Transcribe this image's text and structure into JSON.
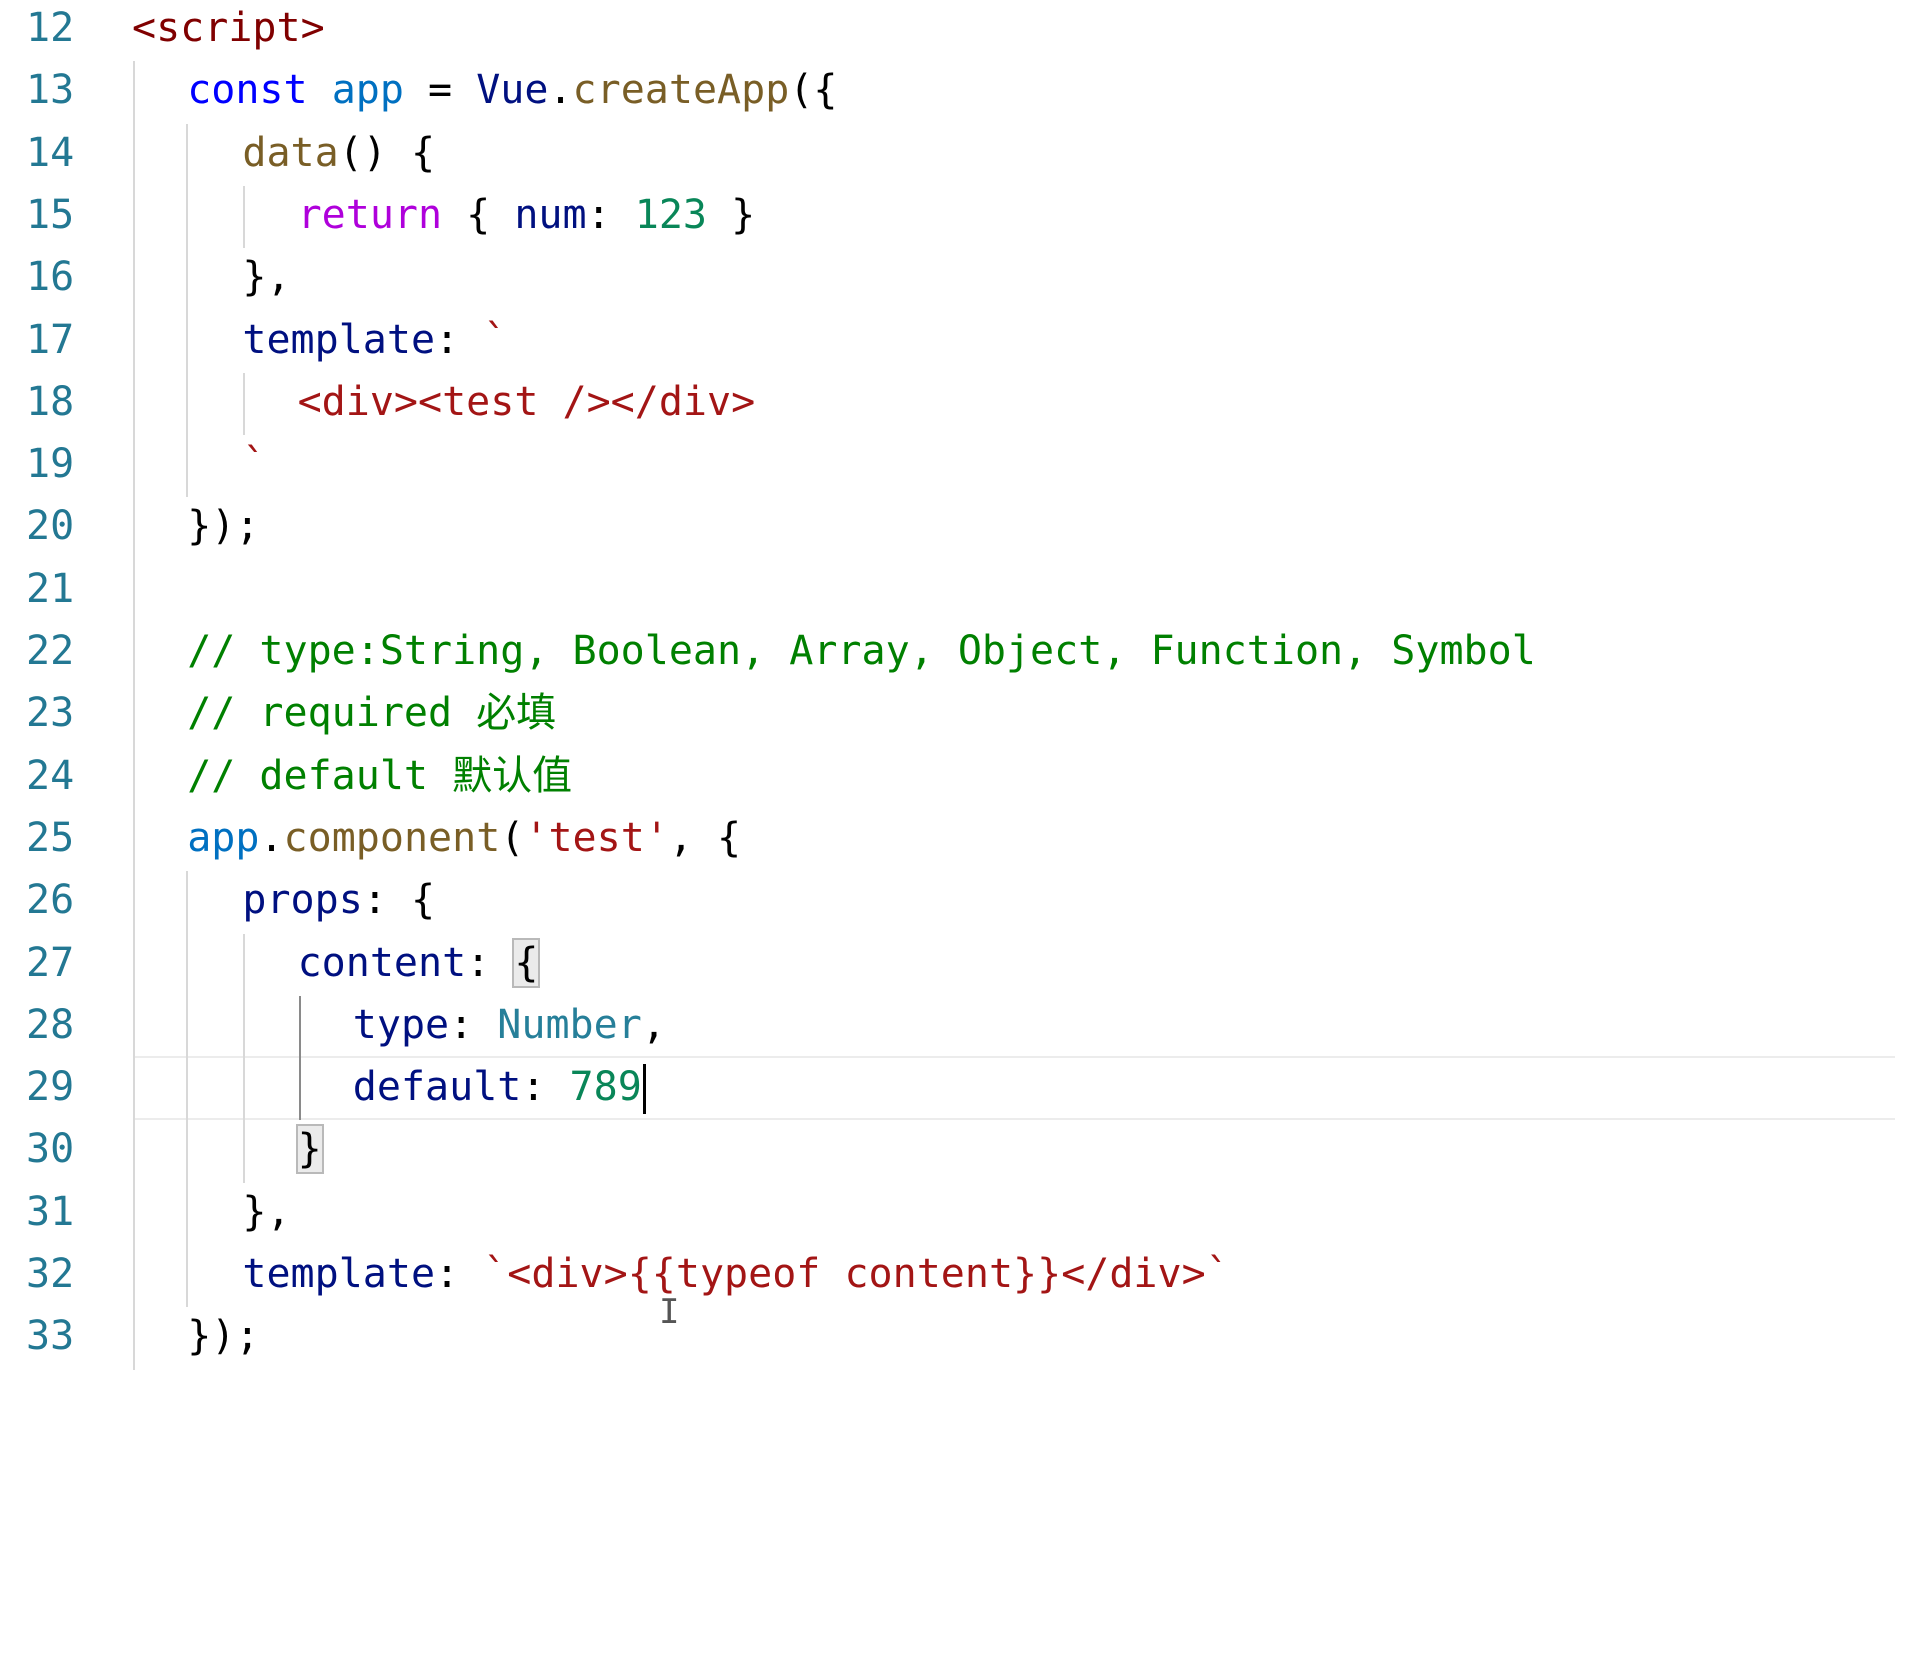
{
  "editor": {
    "colors": {
      "line_number": "#237893",
      "tag": "#800000",
      "keyword": "#0000ff",
      "variable": "#0070c1",
      "function": "#795e26",
      "control": "#af00db",
      "property": "#001080",
      "number": "#098658",
      "string": "#a31515",
      "comment": "#008000",
      "type": "#267f99"
    },
    "cursor_line": 29,
    "lines": [
      {
        "number": "12",
        "tokens": [
          {
            "t": "<script>",
            "c": "tag"
          }
        ]
      },
      {
        "number": "13",
        "tokens": [
          {
            "t": "const",
            "c": "kw"
          },
          {
            "t": " ",
            "c": "plain"
          },
          {
            "t": "app",
            "c": "var"
          },
          {
            "t": " = ",
            "c": "plain"
          },
          {
            "t": "Vue",
            "c": "prop"
          },
          {
            "t": ".",
            "c": "plain"
          },
          {
            "t": "createApp",
            "c": "fn"
          },
          {
            "t": "({",
            "c": "plain"
          }
        ]
      },
      {
        "number": "14",
        "tokens": [
          {
            "t": "data",
            "c": "fn"
          },
          {
            "t": "() {",
            "c": "plain"
          }
        ]
      },
      {
        "number": "15",
        "tokens": [
          {
            "t": "return",
            "c": "ctrl"
          },
          {
            "t": " { ",
            "c": "plain"
          },
          {
            "t": "num",
            "c": "prop"
          },
          {
            "t": ": ",
            "c": "plain"
          },
          {
            "t": "123",
            "c": "num"
          },
          {
            "t": " }",
            "c": "plain"
          }
        ]
      },
      {
        "number": "16",
        "tokens": [
          {
            "t": "},",
            "c": "plain"
          }
        ]
      },
      {
        "number": "17",
        "tokens": [
          {
            "t": "template",
            "c": "prop"
          },
          {
            "t": ": ",
            "c": "plain"
          },
          {
            "t": "`",
            "c": "str"
          }
        ]
      },
      {
        "number": "18",
        "tokens": [
          {
            "t": "<div><test /></div>",
            "c": "str"
          }
        ]
      },
      {
        "number": "19",
        "tokens": [
          {
            "t": "`",
            "c": "str"
          }
        ]
      },
      {
        "number": "20",
        "tokens": [
          {
            "t": "});",
            "c": "plain"
          }
        ]
      },
      {
        "number": "21",
        "tokens": []
      },
      {
        "number": "22",
        "tokens": [
          {
            "t": "// type:String, Boolean, Array, Object, Function, Symbol",
            "c": "cmt"
          }
        ]
      },
      {
        "number": "23",
        "tokens": [
          {
            "t": "// required 必填",
            "c": "cmt"
          }
        ]
      },
      {
        "number": "24",
        "tokens": [
          {
            "t": "// default 默认值",
            "c": "cmt"
          }
        ]
      },
      {
        "number": "25",
        "tokens": [
          {
            "t": "app",
            "c": "var"
          },
          {
            "t": ".",
            "c": "plain"
          },
          {
            "t": "component",
            "c": "fn"
          },
          {
            "t": "(",
            "c": "plain"
          },
          {
            "t": "'test'",
            "c": "str"
          },
          {
            "t": ", {",
            "c": "plain"
          }
        ]
      },
      {
        "number": "26",
        "tokens": [
          {
            "t": "props",
            "c": "prop"
          },
          {
            "t": ": {",
            "c": "plain"
          }
        ]
      },
      {
        "number": "27",
        "tokens": [
          {
            "t": "content",
            "c": "prop"
          },
          {
            "t": ": ",
            "c": "plain"
          },
          {
            "t": "{",
            "c": "plain",
            "match": true
          }
        ]
      },
      {
        "number": "28",
        "tokens": [
          {
            "t": "type",
            "c": "prop"
          },
          {
            "t": ": ",
            "c": "plain"
          },
          {
            "t": "Number",
            "c": "type"
          },
          {
            "t": ",",
            "c": "plain"
          }
        ]
      },
      {
        "number": "29",
        "tokens": [
          {
            "t": "default",
            "c": "prop"
          },
          {
            "t": ": ",
            "c": "plain"
          },
          {
            "t": "789",
            "c": "num"
          }
        ],
        "caret": true
      },
      {
        "number": "30",
        "tokens": [
          {
            "t": "}",
            "c": "plain",
            "match": true
          }
        ]
      },
      {
        "number": "31",
        "tokens": [
          {
            "t": "},",
            "c": "plain"
          }
        ]
      },
      {
        "number": "32",
        "tokens": [
          {
            "t": "template",
            "c": "prop"
          },
          {
            "t": ": ",
            "c": "plain"
          },
          {
            "t": "`<div>{{typeof content}}</div>`",
            "c": "str"
          }
        ]
      },
      {
        "number": "33",
        "tokens": [
          {
            "t": "});",
            "c": "plain"
          }
        ]
      }
    ]
  }
}
